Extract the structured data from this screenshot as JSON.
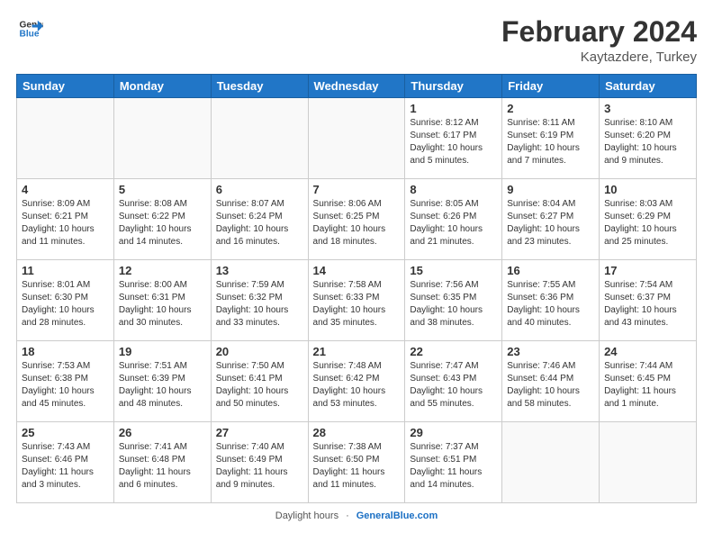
{
  "header": {
    "logo_line1": "General",
    "logo_line2": "Blue",
    "title": "February 2024",
    "location": "Kaytazdere, Turkey"
  },
  "days_of_week": [
    "Sunday",
    "Monday",
    "Tuesday",
    "Wednesday",
    "Thursday",
    "Friday",
    "Saturday"
  ],
  "weeks": [
    [
      {
        "day": "",
        "info": ""
      },
      {
        "day": "",
        "info": ""
      },
      {
        "day": "",
        "info": ""
      },
      {
        "day": "",
        "info": ""
      },
      {
        "day": "1",
        "info": "Sunrise: 8:12 AM\nSunset: 6:17 PM\nDaylight: 10 hours\nand 5 minutes."
      },
      {
        "day": "2",
        "info": "Sunrise: 8:11 AM\nSunset: 6:19 PM\nDaylight: 10 hours\nand 7 minutes."
      },
      {
        "day": "3",
        "info": "Sunrise: 8:10 AM\nSunset: 6:20 PM\nDaylight: 10 hours\nand 9 minutes."
      }
    ],
    [
      {
        "day": "4",
        "info": "Sunrise: 8:09 AM\nSunset: 6:21 PM\nDaylight: 10 hours\nand 11 minutes."
      },
      {
        "day": "5",
        "info": "Sunrise: 8:08 AM\nSunset: 6:22 PM\nDaylight: 10 hours\nand 14 minutes."
      },
      {
        "day": "6",
        "info": "Sunrise: 8:07 AM\nSunset: 6:24 PM\nDaylight: 10 hours\nand 16 minutes."
      },
      {
        "day": "7",
        "info": "Sunrise: 8:06 AM\nSunset: 6:25 PM\nDaylight: 10 hours\nand 18 minutes."
      },
      {
        "day": "8",
        "info": "Sunrise: 8:05 AM\nSunset: 6:26 PM\nDaylight: 10 hours\nand 21 minutes."
      },
      {
        "day": "9",
        "info": "Sunrise: 8:04 AM\nSunset: 6:27 PM\nDaylight: 10 hours\nand 23 minutes."
      },
      {
        "day": "10",
        "info": "Sunrise: 8:03 AM\nSunset: 6:29 PM\nDaylight: 10 hours\nand 25 minutes."
      }
    ],
    [
      {
        "day": "11",
        "info": "Sunrise: 8:01 AM\nSunset: 6:30 PM\nDaylight: 10 hours\nand 28 minutes."
      },
      {
        "day": "12",
        "info": "Sunrise: 8:00 AM\nSunset: 6:31 PM\nDaylight: 10 hours\nand 30 minutes."
      },
      {
        "day": "13",
        "info": "Sunrise: 7:59 AM\nSunset: 6:32 PM\nDaylight: 10 hours\nand 33 minutes."
      },
      {
        "day": "14",
        "info": "Sunrise: 7:58 AM\nSunset: 6:33 PM\nDaylight: 10 hours\nand 35 minutes."
      },
      {
        "day": "15",
        "info": "Sunrise: 7:56 AM\nSunset: 6:35 PM\nDaylight: 10 hours\nand 38 minutes."
      },
      {
        "day": "16",
        "info": "Sunrise: 7:55 AM\nSunset: 6:36 PM\nDaylight: 10 hours\nand 40 minutes."
      },
      {
        "day": "17",
        "info": "Sunrise: 7:54 AM\nSunset: 6:37 PM\nDaylight: 10 hours\nand 43 minutes."
      }
    ],
    [
      {
        "day": "18",
        "info": "Sunrise: 7:53 AM\nSunset: 6:38 PM\nDaylight: 10 hours\nand 45 minutes."
      },
      {
        "day": "19",
        "info": "Sunrise: 7:51 AM\nSunset: 6:39 PM\nDaylight: 10 hours\nand 48 minutes."
      },
      {
        "day": "20",
        "info": "Sunrise: 7:50 AM\nSunset: 6:41 PM\nDaylight: 10 hours\nand 50 minutes."
      },
      {
        "day": "21",
        "info": "Sunrise: 7:48 AM\nSunset: 6:42 PM\nDaylight: 10 hours\nand 53 minutes."
      },
      {
        "day": "22",
        "info": "Sunrise: 7:47 AM\nSunset: 6:43 PM\nDaylight: 10 hours\nand 55 minutes."
      },
      {
        "day": "23",
        "info": "Sunrise: 7:46 AM\nSunset: 6:44 PM\nDaylight: 10 hours\nand 58 minutes."
      },
      {
        "day": "24",
        "info": "Sunrise: 7:44 AM\nSunset: 6:45 PM\nDaylight: 11 hours\nand 1 minute."
      }
    ],
    [
      {
        "day": "25",
        "info": "Sunrise: 7:43 AM\nSunset: 6:46 PM\nDaylight: 11 hours\nand 3 minutes."
      },
      {
        "day": "26",
        "info": "Sunrise: 7:41 AM\nSunset: 6:48 PM\nDaylight: 11 hours\nand 6 minutes."
      },
      {
        "day": "27",
        "info": "Sunrise: 7:40 AM\nSunset: 6:49 PM\nDaylight: 11 hours\nand 9 minutes."
      },
      {
        "day": "28",
        "info": "Sunrise: 7:38 AM\nSunset: 6:50 PM\nDaylight: 11 hours\nand 11 minutes."
      },
      {
        "day": "29",
        "info": "Sunrise: 7:37 AM\nSunset: 6:51 PM\nDaylight: 11 hours\nand 14 minutes."
      },
      {
        "day": "",
        "info": ""
      },
      {
        "day": "",
        "info": ""
      }
    ]
  ],
  "footer": {
    "daylight_label": "Daylight hours",
    "source": "GeneralBlue.com"
  }
}
